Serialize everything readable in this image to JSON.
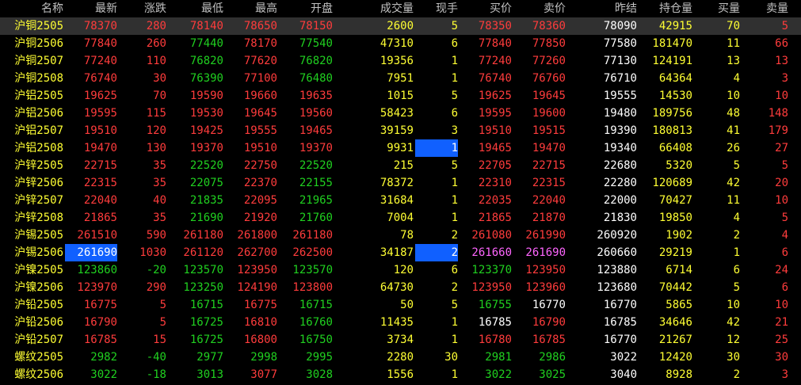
{
  "columns": {
    "name": "名称",
    "last": "最新",
    "chg": "涨跌",
    "low": "最低",
    "high": "最高",
    "open": "开盘",
    "vol": "成交量",
    "cur": "现手",
    "bid": "买价",
    "ask": "卖价",
    "prev": "昨结",
    "oi": "持仓量",
    "bvol": "买量",
    "avol": "卖量"
  },
  "colors": {
    "up": "#ff3c3c",
    "down": "#20d020",
    "flat": "#ffffff",
    "name": "#ffff00",
    "highlight": "#1060ff"
  },
  "rows": [
    {
      "name": "沪铜2505",
      "last": "78370",
      "chg": "280",
      "low": "78140",
      "high": "78650",
      "open": "78150",
      "vol": "2600",
      "cur": "5",
      "bid": "78350",
      "ask": "78360",
      "prev": "78090",
      "oi": "42915",
      "bvol": "70",
      "avol": "5"
    },
    {
      "name": "沪铜2506",
      "last": "77840",
      "chg": "260",
      "low": "77440",
      "high": "78170",
      "open": "77540",
      "vol": "47310",
      "cur": "6",
      "bid": "77840",
      "ask": "77850",
      "prev": "77580",
      "oi": "181470",
      "bvol": "11",
      "avol": "66"
    },
    {
      "name": "沪铜2507",
      "last": "77240",
      "chg": "110",
      "low": "76820",
      "high": "77620",
      "open": "76820",
      "vol": "19356",
      "cur": "1",
      "bid": "77240",
      "ask": "77260",
      "prev": "77130",
      "oi": "124191",
      "bvol": "13",
      "avol": "13"
    },
    {
      "name": "沪铜2508",
      "last": "76740",
      "chg": "30",
      "low": "76390",
      "high": "77100",
      "open": "76480",
      "vol": "7951",
      "cur": "1",
      "bid": "76740",
      "ask": "76760",
      "prev": "76710",
      "oi": "64364",
      "bvol": "4",
      "avol": "3"
    },
    {
      "name": "沪铝2505",
      "last": "19625",
      "chg": "70",
      "low": "19590",
      "high": "19660",
      "open": "19635",
      "vol": "1015",
      "cur": "5",
      "bid": "19625",
      "ask": "19645",
      "prev": "19555",
      "oi": "14530",
      "bvol": "10",
      "avol": "10"
    },
    {
      "name": "沪铝2506",
      "last": "19595",
      "chg": "115",
      "low": "19530",
      "high": "19645",
      "open": "19560",
      "vol": "58423",
      "cur": "6",
      "bid": "19595",
      "ask": "19600",
      "prev": "19480",
      "oi": "189756",
      "bvol": "48",
      "avol": "148"
    },
    {
      "name": "沪铝2507",
      "last": "19510",
      "chg": "120",
      "low": "19425",
      "high": "19555",
      "open": "19465",
      "vol": "39159",
      "cur": "3",
      "bid": "19510",
      "ask": "19515",
      "prev": "19390",
      "oi": "180813",
      "bvol": "41",
      "avol": "179"
    },
    {
      "name": "沪铝2508",
      "last": "19470",
      "chg": "130",
      "low": "19370",
      "high": "19510",
      "open": "19370",
      "vol": "9931",
      "cur": "1",
      "bid": "19465",
      "ask": "19470",
      "prev": "19340",
      "oi": "66408",
      "bvol": "26",
      "avol": "27"
    },
    {
      "name": "沪锌2505",
      "last": "22715",
      "chg": "35",
      "low": "22520",
      "high": "22750",
      "open": "22520",
      "vol": "215",
      "cur": "5",
      "bid": "22705",
      "ask": "22715",
      "prev": "22680",
      "oi": "5320",
      "bvol": "5",
      "avol": "5"
    },
    {
      "name": "沪锌2506",
      "last": "22315",
      "chg": "35",
      "low": "22075",
      "high": "22370",
      "open": "22155",
      "vol": "78372",
      "cur": "1",
      "bid": "22310",
      "ask": "22315",
      "prev": "22280",
      "oi": "120689",
      "bvol": "42",
      "avol": "20"
    },
    {
      "name": "沪锌2507",
      "last": "22040",
      "chg": "40",
      "low": "21835",
      "high": "22095",
      "open": "21965",
      "vol": "31684",
      "cur": "1",
      "bid": "22035",
      "ask": "22040",
      "prev": "22000",
      "oi": "70427",
      "bvol": "11",
      "avol": "10"
    },
    {
      "name": "沪锌2508",
      "last": "21865",
      "chg": "35",
      "low": "21690",
      "high": "21920",
      "open": "21760",
      "vol": "7004",
      "cur": "1",
      "bid": "21865",
      "ask": "21870",
      "prev": "21830",
      "oi": "19850",
      "bvol": "4",
      "avol": "5"
    },
    {
      "name": "沪锡2505",
      "last": "261510",
      "chg": "590",
      "low": "261180",
      "high": "261800",
      "open": "261180",
      "vol": "78",
      "cur": "2",
      "bid": "261080",
      "ask": "261990",
      "prev": "260920",
      "oi": "1902",
      "bvol": "2",
      "avol": "4"
    },
    {
      "name": "沪锡2506",
      "last": "261690",
      "chg": "1030",
      "low": "261120",
      "high": "262700",
      "open": "262500",
      "vol": "34187",
      "cur": "2",
      "bid": "261660",
      "ask": "261690",
      "prev": "260660",
      "oi": "29219",
      "bvol": "1",
      "avol": "6"
    },
    {
      "name": "沪镍2505",
      "last": "123860",
      "chg": "-20",
      "low": "123570",
      "high": "123950",
      "open": "123570",
      "vol": "120",
      "cur": "6",
      "bid": "123370",
      "ask": "123950",
      "prev": "123880",
      "oi": "6714",
      "bvol": "6",
      "avol": "24"
    },
    {
      "name": "沪镍2506",
      "last": "123970",
      "chg": "290",
      "low": "123250",
      "high": "124190",
      "open": "123800",
      "vol": "64730",
      "cur": "2",
      "bid": "123950",
      "ask": "123960",
      "prev": "123680",
      "oi": "70442",
      "bvol": "5",
      "avol": "6"
    },
    {
      "name": "沪铅2505",
      "last": "16775",
      "chg": "5",
      "low": "16715",
      "high": "16775",
      "open": "16715",
      "vol": "50",
      "cur": "5",
      "bid": "16755",
      "ask": "16770",
      "prev": "16770",
      "oi": "5865",
      "bvol": "10",
      "avol": "10"
    },
    {
      "name": "沪铅2506",
      "last": "16790",
      "chg": "5",
      "low": "16725",
      "high": "16810",
      "open": "16760",
      "vol": "11435",
      "cur": "1",
      "bid": "16785",
      "ask": "16790",
      "prev": "16785",
      "oi": "34646",
      "bvol": "42",
      "avol": "21"
    },
    {
      "name": "沪铅2507",
      "last": "16785",
      "chg": "15",
      "low": "16725",
      "high": "16800",
      "open": "16750",
      "vol": "3734",
      "cur": "1",
      "bid": "16780",
      "ask": "16785",
      "prev": "16770",
      "oi": "21267",
      "bvol": "12",
      "avol": "25"
    },
    {
      "name": "螺纹2505",
      "last": "2982",
      "chg": "-40",
      "low": "2977",
      "high": "2998",
      "open": "2995",
      "vol": "2280",
      "cur": "30",
      "bid": "2981",
      "ask": "2986",
      "prev": "3022",
      "oi": "12420",
      "bvol": "30",
      "avol": "30"
    },
    {
      "name": "螺纹2506",
      "last": "3022",
      "chg": "-18",
      "low": "3013",
      "high": "3077",
      "open": "3028",
      "vol": "1556",
      "cur": "1",
      "bid": "3022",
      "ask": "3025",
      "prev": "3040",
      "oi": "8928",
      "bvol": "2",
      "avol": "3"
    }
  ]
}
